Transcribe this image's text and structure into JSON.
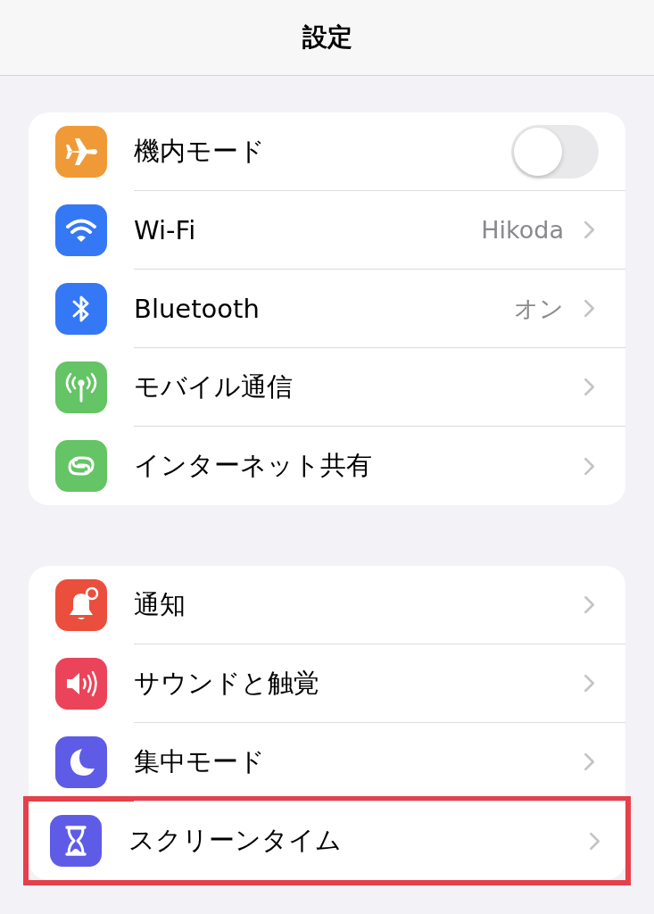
{
  "navigation_bar": {
    "title": "設定"
  },
  "groups": [
    {
      "rows": [
        {
          "label": "機内モード",
          "kind": "toggle",
          "on": false,
          "color": "#f09a37",
          "highlighted": false
        },
        {
          "label": "Wi-Fi",
          "kind": "value",
          "value": "Hikoda",
          "color": "#3478f6",
          "highlighted": false
        },
        {
          "label": "Bluetooth",
          "kind": "value",
          "value": "オン",
          "color": "#3478f6",
          "highlighted": false
        },
        {
          "label": "モバイル通信",
          "kind": "link",
          "color": "#65c466",
          "highlighted": false
        },
        {
          "label": "インターネット共有",
          "kind": "link",
          "color": "#65c466",
          "highlighted": false
        }
      ]
    },
    {
      "rows": [
        {
          "label": "通知",
          "kind": "link",
          "color": "#eb4e3d",
          "highlighted": false
        },
        {
          "label": "サウンドと触覚",
          "kind": "link",
          "color": "#eb445a",
          "highlighted": false
        },
        {
          "label": "集中モード",
          "kind": "link",
          "color": "#5e5ce6",
          "highlighted": false
        },
        {
          "label": "スクリーンタイム",
          "kind": "link",
          "color": "#5e5ce6",
          "highlighted": true
        }
      ]
    }
  ]
}
